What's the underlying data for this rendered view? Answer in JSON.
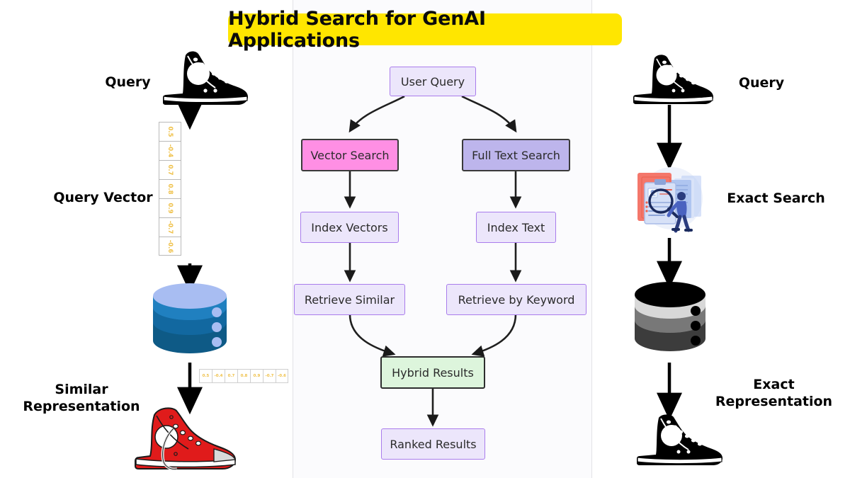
{
  "title": "Hybrid Search for GenAI Applications",
  "theme": {
    "title_bg": "#FFE600",
    "title_text": "#0b0b0b",
    "node_lilac_bg": "#ECE6FB",
    "node_lilac_border": "#A97CEC",
    "node_pink_bg": "#FF8FE4",
    "node_violet_bg": "#BDB5EC",
    "node_green_bg": "#DDF5DC",
    "node_dark_border": "#3a3a3a",
    "arrow_color": "#1a1a1a",
    "panel_divider": "#e2e2e6",
    "center_panel_bg": "#fbfbfd",
    "db_blue_top": "#A8BDF2",
    "db_blue_mid": "#2080C0",
    "db_blue_dark": "#0E5A86",
    "db_gray_top": "#000000",
    "db_gray_light": "#D8D8D8",
    "db_gray_mid": "#787878",
    "db_gray_dark": "#3C3C3C",
    "shoe_red": "#E01B1B",
    "shoe_black": "#000000",
    "vector_text": "#EFC14A"
  },
  "left_panel": {
    "query_label": "Query",
    "query_vector_label": "Query Vector",
    "result_label": "Similar\nRepresentation",
    "query_shoe": "black-high-top-sneaker",
    "result_shoe": "red-high-top-sneaker",
    "database": "blue-database-cylinder",
    "vector_values": [
      "0.5",
      "-0.4",
      "0.7",
      "0.8",
      "0.9",
      "-0.7",
      "-0.6"
    ],
    "stored_vector_values": [
      "0.5",
      "-0.4",
      "0.7",
      "0.8",
      "0.9",
      "-0.7",
      "-0.6"
    ]
  },
  "right_panel": {
    "query_label": "Query",
    "search_label": "Exact Search",
    "result_label": "Exact\nRepresentation",
    "query_shoe": "black-high-top-sneaker",
    "result_shoe": "black-high-top-sneaker",
    "database": "gray-database-cylinder",
    "illustration": "person-with-magnifier-documents-illustration"
  },
  "flowchart": {
    "nodes": [
      {
        "id": "user-query",
        "label": "User Query",
        "style": "lilac"
      },
      {
        "id": "vector-search",
        "label": "Vector Search",
        "style": "pink"
      },
      {
        "id": "full-text-search",
        "label": "Full Text Search",
        "style": "violet"
      },
      {
        "id": "index-vectors",
        "label": "Index Vectors",
        "style": "lilac"
      },
      {
        "id": "index-text",
        "label": "Index Text",
        "style": "lilac"
      },
      {
        "id": "retrieve-similar",
        "label": "Retrieve Similar",
        "style": "lilac"
      },
      {
        "id": "retrieve-by-keyword",
        "label": "Retrieve by Keyword",
        "style": "lilac"
      },
      {
        "id": "hybrid-results",
        "label": "Hybrid Results",
        "style": "green"
      },
      {
        "id": "ranked-results",
        "label": "Ranked Results",
        "style": "lilac"
      }
    ],
    "edges": [
      {
        "from": "user-query",
        "to": "vector-search"
      },
      {
        "from": "user-query",
        "to": "full-text-search"
      },
      {
        "from": "vector-search",
        "to": "index-vectors"
      },
      {
        "from": "full-text-search",
        "to": "index-text"
      },
      {
        "from": "index-vectors",
        "to": "retrieve-similar"
      },
      {
        "from": "index-text",
        "to": "retrieve-by-keyword"
      },
      {
        "from": "retrieve-similar",
        "to": "hybrid-results"
      },
      {
        "from": "retrieve-by-keyword",
        "to": "hybrid-results"
      },
      {
        "from": "hybrid-results",
        "to": "ranked-results"
      }
    ]
  }
}
